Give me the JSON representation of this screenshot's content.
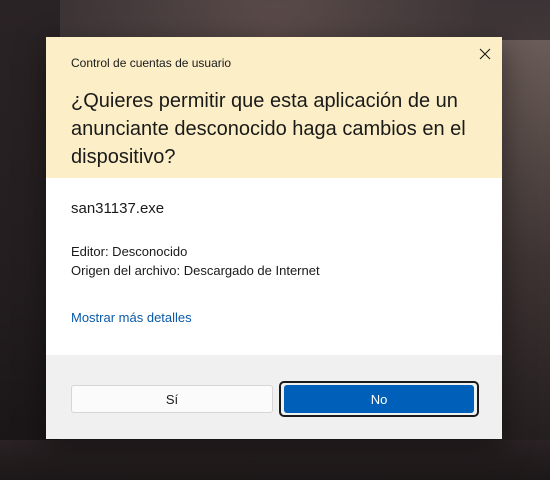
{
  "dialog": {
    "app_title": "Control de cuentas de usuario",
    "question": "¿Quieres permitir que esta aplicación de un anunciante desconocido haga cambios en el dispositivo?",
    "program_name": "san31137.exe",
    "publisher": "Editor: Desconocido",
    "origin": "Origen del archivo: Descargado de Internet",
    "details_link": "Mostrar más detalles",
    "yes_label": "Sí",
    "no_label": "No",
    "close_icon": "close-icon"
  },
  "colors": {
    "header_bg": "#fcefc7",
    "body_bg": "#ffffff",
    "footer_bg": "#f0f0f0",
    "link": "#0a5aa8",
    "primary_button": "#005fb8"
  }
}
